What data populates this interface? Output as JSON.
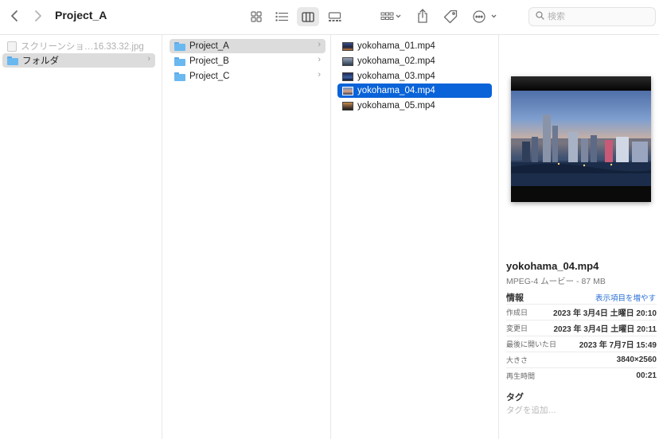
{
  "toolbar": {
    "title": "Project_A",
    "back_icon": "chevron-left-icon",
    "forward_icon": "chevron-right-icon",
    "views": [
      "icon-view-icon",
      "list-view-icon",
      "column-view-icon",
      "gallery-view-icon"
    ],
    "active_view": "column-view-icon",
    "actions": [
      "group-icon",
      "share-icon",
      "tag-icon",
      "more-icon"
    ],
    "search_placeholder": "検索"
  },
  "columns": [
    {
      "items": [
        {
          "label": "スクリーンショ…16.33.32.jpg",
          "icon": "image-file-icon",
          "dimmed": true
        },
        {
          "label": "フォルダ",
          "icon": "folder-icon",
          "selected": "grey",
          "chevron": "›"
        }
      ]
    },
    {
      "items": [
        {
          "label": "Project_A",
          "icon": "folder-icon",
          "selected": "grey",
          "chevron": "›"
        },
        {
          "label": "Project_B",
          "icon": "folder-icon",
          "chevron": "›"
        },
        {
          "label": "Project_C",
          "icon": "folder-icon",
          "chevron": "›"
        }
      ]
    },
    {
      "items": [
        {
          "label": "yokohama_01.mp4",
          "icon": "video-thumbnail-icon"
        },
        {
          "label": "yokohama_02.mp4",
          "icon": "video-thumbnail-icon"
        },
        {
          "label": "yokohama_03.mp4",
          "icon": "video-thumbnail-icon"
        },
        {
          "label": "yokohama_04.mp4",
          "icon": "video-thumbnail-icon",
          "selected": "blue"
        },
        {
          "label": "yokohama_05.mp4",
          "icon": "video-thumbnail-icon"
        }
      ]
    }
  ],
  "preview": {
    "filename": "yokohama_04.mp4",
    "kind": "MPEG-4 ムービー - 87 MB",
    "info_heading": "情報",
    "show_more": "表示項目を増やす",
    "info": [
      {
        "key": "作成日",
        "value": "2023 年 3月4日 土曜日 20:10"
      },
      {
        "key": "変更日",
        "value": "2023 年 3月4日 土曜日 20:11"
      },
      {
        "key": "最後に開いた日",
        "value": "2023 年 7月7日 15:49"
      },
      {
        "key": "大きさ",
        "value": "3840×2560"
      },
      {
        "key": "再生時間",
        "value": "00:21"
      }
    ],
    "tags_heading": "タグ",
    "tags_placeholder": "タグを追加…"
  },
  "colors": {
    "selection_blue": "#0a63d8",
    "selection_grey": "#dcdcdc",
    "folder": "#6ab8f0",
    "link": "#2a6fd6"
  }
}
